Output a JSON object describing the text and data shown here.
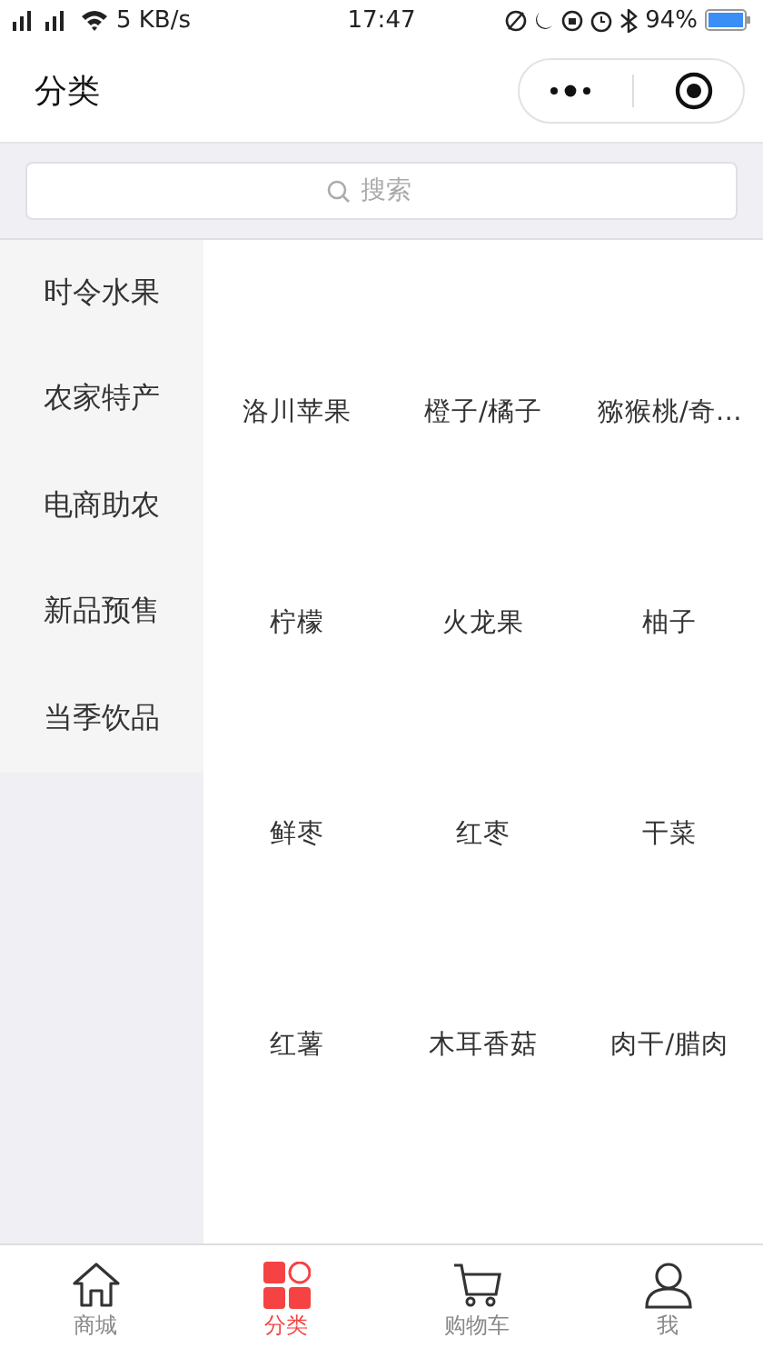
{
  "status_bar": {
    "speed": "5 KB/s",
    "time": "17:47",
    "battery": "94%"
  },
  "header": {
    "title": "分类"
  },
  "search": {
    "placeholder": "搜索"
  },
  "sidebar": {
    "items": [
      {
        "label": "时令水果"
      },
      {
        "label": "农家特产"
      },
      {
        "label": "电商助农"
      },
      {
        "label": "新品预售"
      },
      {
        "label": "当季饮品"
      }
    ]
  },
  "products": [
    {
      "label": "洛川苹果"
    },
    {
      "label": "橙子/橘子"
    },
    {
      "label": "猕猴桃/奇…"
    },
    {
      "label": "柠檬"
    },
    {
      "label": "火龙果"
    },
    {
      "label": "柚子"
    },
    {
      "label": "鲜枣"
    },
    {
      "label": "红枣"
    },
    {
      "label": "干菜"
    },
    {
      "label": "红薯"
    },
    {
      "label": "木耳香菇"
    },
    {
      "label": "肉干/腊肉"
    }
  ],
  "tab_bar": [
    {
      "label": "商城",
      "kind": "home",
      "selected": false
    },
    {
      "label": "分类",
      "kind": "category",
      "selected": true
    },
    {
      "label": "购物车",
      "kind": "cart",
      "selected": false
    },
    {
      "label": "我",
      "kind": "user",
      "selected": false
    }
  ]
}
